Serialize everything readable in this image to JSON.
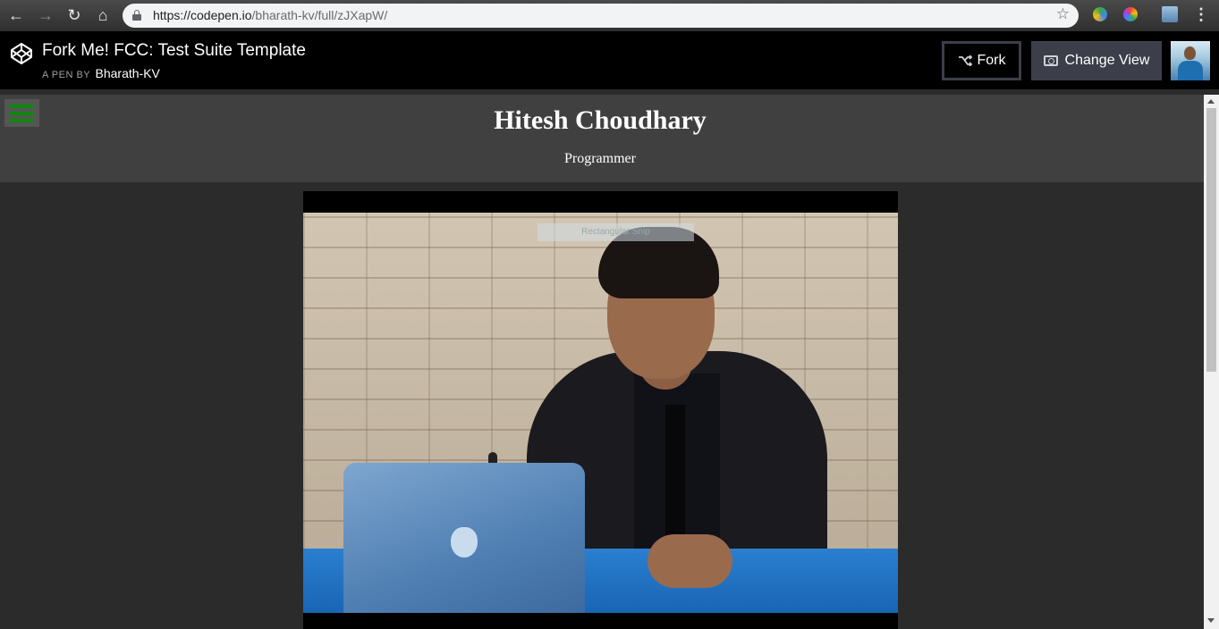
{
  "browser": {
    "url_host": "https://codepen.io",
    "url_path": "/bharath-kv/full/zJXapW/"
  },
  "codepen": {
    "title": "Fork Me! FCC: Test Suite Template",
    "pen_by_label": "A PEN BY",
    "author": "Bharath-KV",
    "fork_label": "Fork",
    "change_view_label": "Change View"
  },
  "page": {
    "name": "Hitesh Choudhary",
    "role": "Programmer",
    "photo_overlay_text": "Rectangular Snip"
  },
  "icons": {
    "back": "arrow-left-icon",
    "forward": "arrow-right-icon",
    "reload": "reload-icon",
    "home": "home-icon",
    "lock": "lock-icon",
    "bookmark": "star-icon",
    "menu": "hamburger-icon",
    "codepen": "codepen-logo-icon",
    "fork": "fork-icon",
    "view": "eye-icon"
  },
  "colors": {
    "header_bg": "#000000",
    "button_bg": "#3c3f49",
    "page_header_bg": "#404040",
    "page_bg": "#2b2b2b",
    "hamburger": "#0d8a0d"
  }
}
